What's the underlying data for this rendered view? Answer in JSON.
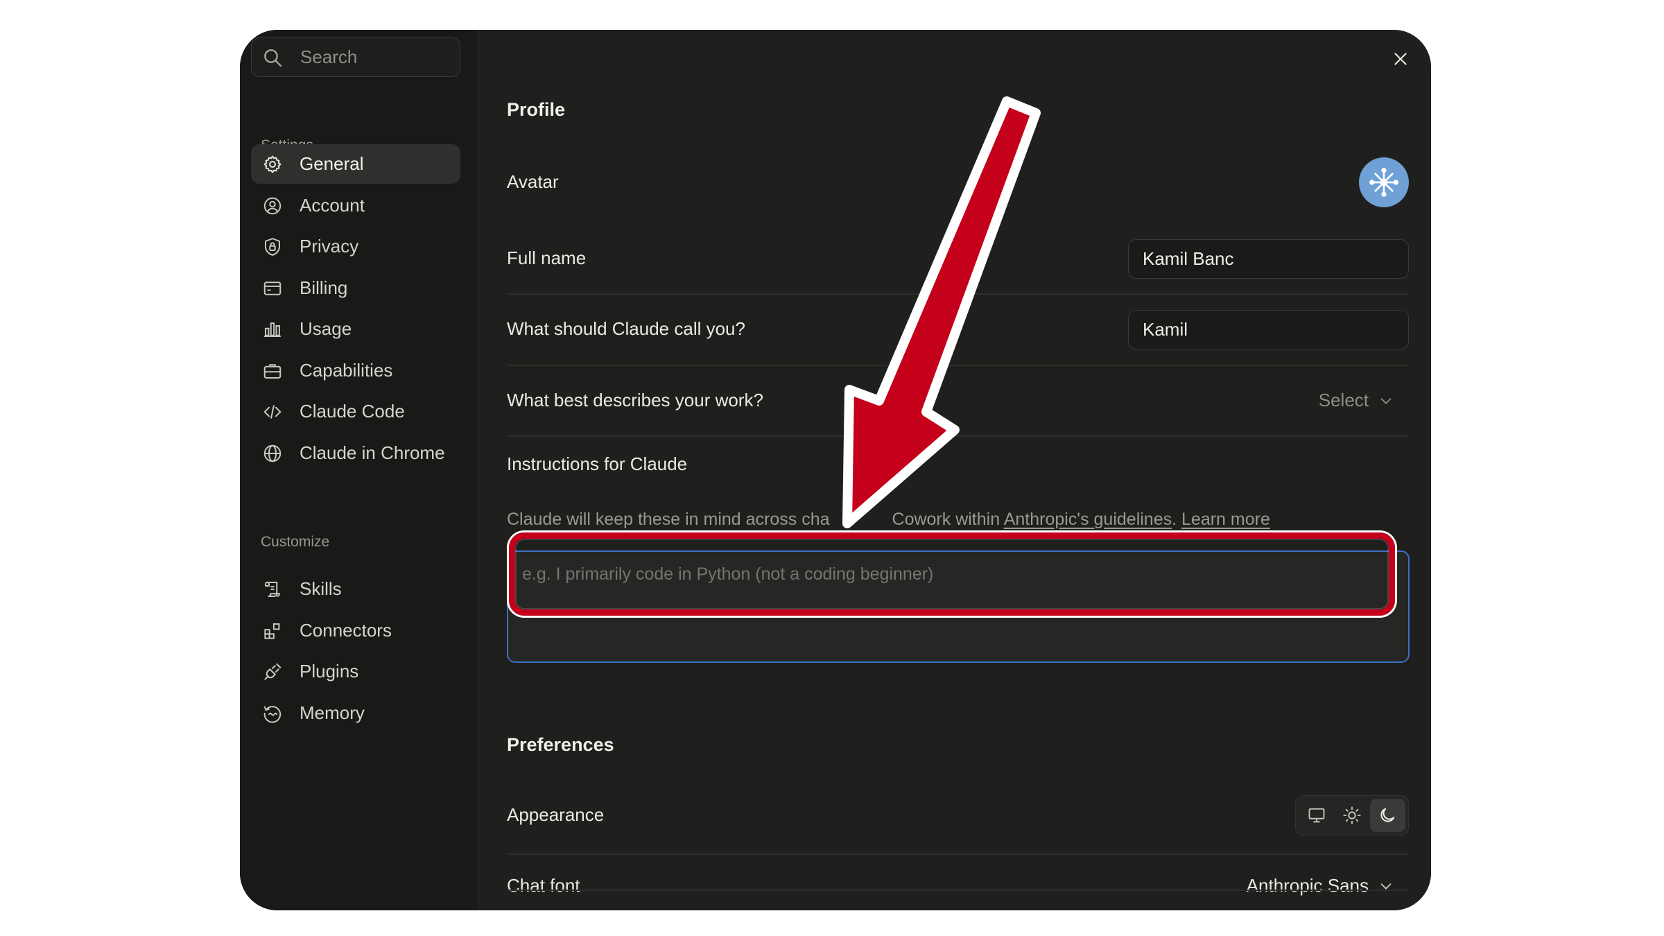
{
  "sidebar": {
    "search_placeholder": "Search",
    "settings_label": "Settings",
    "settings_items": [
      {
        "label": "General",
        "icon": "gear-icon",
        "active": true
      },
      {
        "label": "Account",
        "icon": "user-circle-icon"
      },
      {
        "label": "Privacy",
        "icon": "shield-lock-icon"
      },
      {
        "label": "Billing",
        "icon": "credit-card-icon"
      },
      {
        "label": "Usage",
        "icon": "bar-chart-icon"
      },
      {
        "label": "Capabilities",
        "icon": "briefcase-icon"
      },
      {
        "label": "Claude Code",
        "icon": "code-brackets-icon"
      },
      {
        "label": "Claude in Chrome",
        "icon": "globe-icon"
      }
    ],
    "customize_label": "Customize",
    "customize_items": [
      {
        "label": "Skills",
        "icon": "scroll-icon"
      },
      {
        "label": "Connectors",
        "icon": "blocks-icon"
      },
      {
        "label": "Plugins",
        "icon": "plug-icon"
      },
      {
        "label": "Memory",
        "icon": "history-icon"
      }
    ]
  },
  "profile": {
    "heading": "Profile",
    "avatar_label": "Avatar",
    "full_name_label": "Full name",
    "full_name_value": "Kamil Banc",
    "call_you_label": "What should Claude call you?",
    "call_you_value": "Kamil",
    "work_label": "What best describes your work?",
    "work_select": "Select",
    "instructions_label": "Instructions for Claude",
    "instructions_desc_prefix": "Claude will keep these in mind across cha",
    "instructions_desc_mid": "Cowork within ",
    "instructions_desc_link1": "Anthropic's guidelines",
    "instructions_desc_sep": ". ",
    "instructions_desc_link2": "Learn more",
    "instructions_placeholder": "e.g. I primarily code in Python (not a coding beginner)"
  },
  "preferences": {
    "heading": "Preferences",
    "appearance_label": "Appearance",
    "appearance_options": [
      "monitor-icon",
      "sun-icon",
      "moon-icon"
    ],
    "appearance_selected": "moon-icon",
    "chat_font_label": "Chat font",
    "chat_font_value": "Anthropic Sans"
  },
  "colors": {
    "annotation_red": "#c4001a",
    "focus_blue": "#3f6fc6",
    "avatar_blue": "#6fa0d6"
  }
}
